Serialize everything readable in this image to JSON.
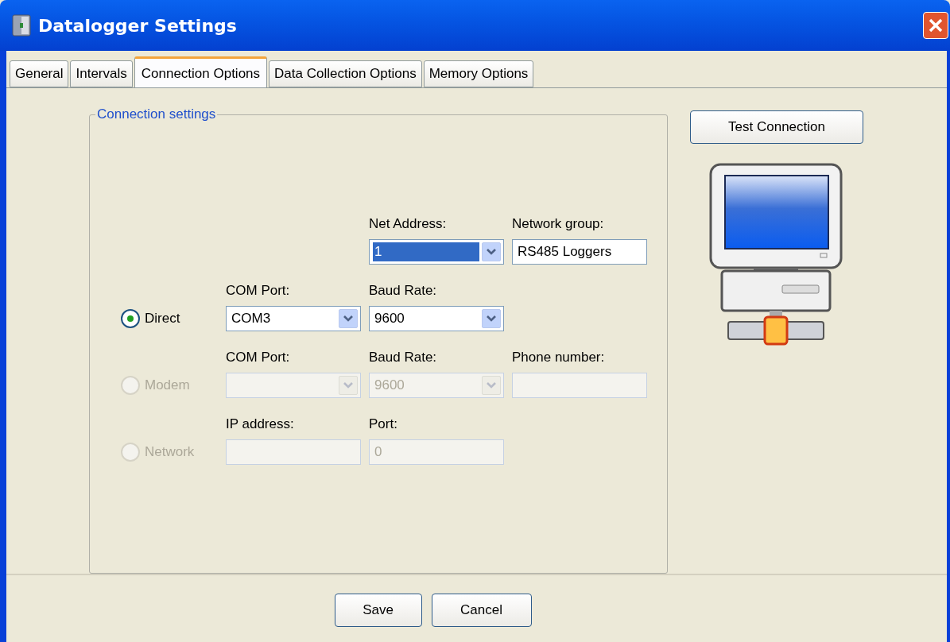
{
  "window": {
    "title": "Datalogger Settings"
  },
  "tabs": [
    {
      "label": "General",
      "selected": false
    },
    {
      "label": "Intervals",
      "selected": false
    },
    {
      "label": "Connection Options",
      "selected": true
    },
    {
      "label": "Data Collection Options",
      "selected": false
    },
    {
      "label": "Memory Options",
      "selected": false
    }
  ],
  "group": {
    "title": "Connection settings"
  },
  "net_fields": [
    {
      "kind": "dropdown",
      "label": "Net Address:",
      "value": "1",
      "highlighted": true
    },
    {
      "kind": "text",
      "label": "Network group:",
      "value": "RS485 Loggers",
      "highlighted": false
    }
  ],
  "connection_modes": [
    {
      "label": "Direct",
      "selected": true,
      "disabled": false,
      "fields": [
        {
          "kind": "dropdown",
          "label": "COM Port:",
          "value": "COM3"
        },
        {
          "kind": "dropdown",
          "label": "Baud Rate:",
          "value": "9600"
        }
      ]
    },
    {
      "label": "Modem",
      "selected": false,
      "disabled": true,
      "fields": [
        {
          "kind": "dropdown",
          "label": "COM Port:"
        },
        {
          "kind": "dropdown",
          "label": "Baud Rate:",
          "value": "9600"
        },
        {
          "kind": "text",
          "label": "Phone number:"
        }
      ]
    },
    {
      "label": "Network",
      "selected": false,
      "disabled": true,
      "fields": [
        {
          "kind": "text",
          "label": "IP address:"
        },
        {
          "kind": "text",
          "label": "Port:",
          "value": "0"
        }
      ]
    }
  ],
  "test_button": "Test Connection",
  "buttons": [
    "Save",
    "Cancel"
  ]
}
